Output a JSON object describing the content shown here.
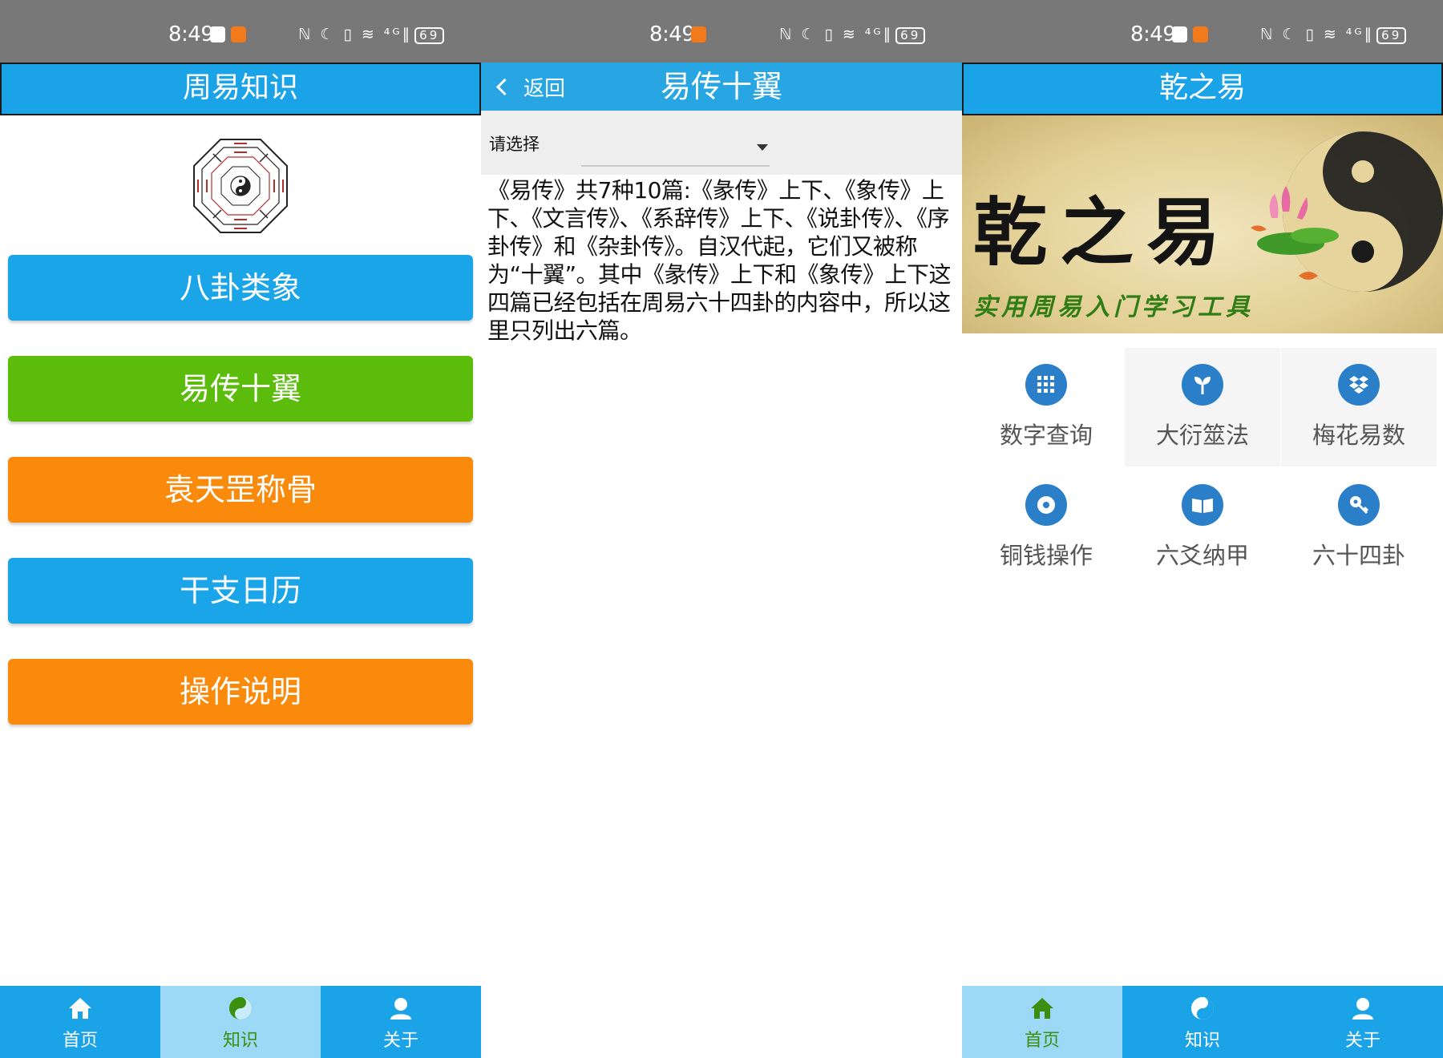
{
  "status_bar": {
    "time": "8:49",
    "icons": "ℕ ☾ ▯ ≋ ⁴ᴳ∥",
    "battery": "69"
  },
  "panel1": {
    "title": "周易知识",
    "buttons": [
      "八卦类象",
      "易传十翼",
      "袁天罡称骨",
      "干支日历",
      "操作说明"
    ]
  },
  "panel2": {
    "back_label": "返回",
    "title": "易传十翼",
    "select_placeholder": "请选择",
    "article": "《易传》共7种10篇:《彖传》上下、《象传》上下、《文言传》、《系辞传》上下、《说卦传》、《序卦传》和《杂卦传》。自汉代起，它们又被称为“十翼”。其中《彖传》上下和《象传》上下这四篇已经包括在周易六十四卦的内容中，所以这里只列出六篇。"
  },
  "panel3": {
    "title": "乾之易",
    "banner_title": "乾之易",
    "banner_subtitle": "实用周易入门学习工具",
    "grid": [
      {
        "label": "数字查询",
        "icon": "keypad-icon"
      },
      {
        "label": "大衍筮法",
        "icon": "sprout-icon"
      },
      {
        "label": "梅花易数",
        "icon": "dropbox-icon"
      },
      {
        "label": "铜钱操作",
        "icon": "coin-icon"
      },
      {
        "label": "六爻纳甲",
        "icon": "book-icon"
      },
      {
        "label": "六十四卦",
        "icon": "key-icon"
      }
    ]
  },
  "tabs": [
    "首页",
    "知识",
    "关于"
  ],
  "colors": {
    "status_bar": "#787878",
    "primary_blue": "#1ba3e8",
    "active_tab": "#9bd9f6",
    "active_tab_text": "#3a8f0e",
    "green": "#5cbc0c",
    "orange": "#fa8a0c",
    "icon_blue": "#2b7ec8"
  }
}
